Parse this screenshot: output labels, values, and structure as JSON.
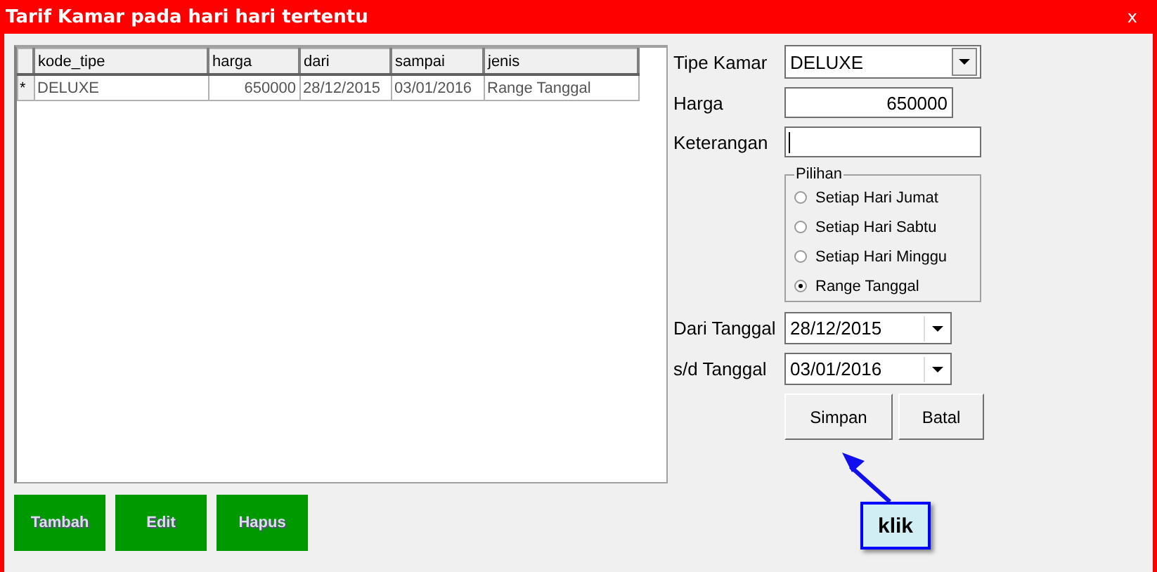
{
  "window": {
    "title": "Tarif Kamar pada hari hari tertentu",
    "close": "x"
  },
  "grid": {
    "columns": [
      "kode_tipe",
      "harga",
      "dari",
      "sampai",
      "jenis"
    ],
    "rows": [
      {
        "marker": "*",
        "cells": [
          "DELUXE",
          "650000",
          "28/12/2015",
          "03/01/2016",
          "Range Tanggal"
        ]
      }
    ]
  },
  "actions": [
    "Tambah",
    "Edit",
    "Hapus"
  ],
  "form": {
    "tipe_kamar": {
      "label": "Tipe Kamar",
      "value": "DELUXE"
    },
    "harga": {
      "label": "Harga",
      "value": "650000"
    },
    "keterangan": {
      "label": "Keterangan"
    },
    "pilihan": {
      "label": "Pilihan",
      "options": [
        {
          "label": "Setiap Hari Jumat",
          "selected": false
        },
        {
          "label": "Setiap Hari Sabtu",
          "selected": false
        },
        {
          "label": "Setiap Hari Minggu",
          "selected": false
        },
        {
          "label": "Range Tanggal",
          "selected": true
        }
      ]
    },
    "dari_tanggal": {
      "label": "Dari Tanggal",
      "value": "28/12/2015"
    },
    "sd_tanggal": {
      "label": "s/d Tanggal",
      "value": "03/01/2016"
    },
    "buttons": [
      "Simpan",
      "Batal"
    ]
  },
  "callout": {
    "text": "klik"
  }
}
